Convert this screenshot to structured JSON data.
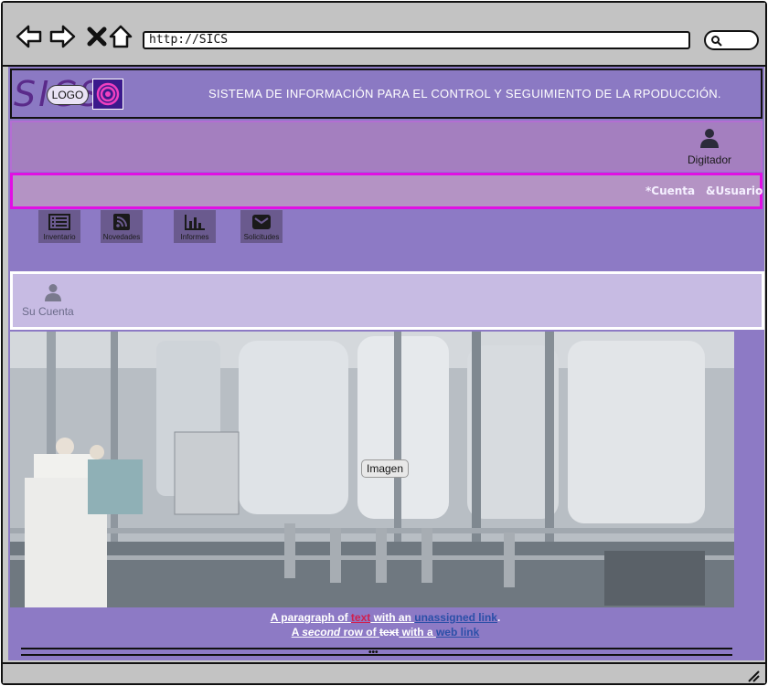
{
  "browser": {
    "url": "http://SICS"
  },
  "header": {
    "brand": "SICS",
    "logo_label": "LOGO",
    "title": "SISTEMA DE INFORMACIÓN PARA EL CONTROL Y SEGUIMIENTO DE LA RPODUCCIÓN."
  },
  "user": {
    "role": "Digitador"
  },
  "account_nav": {
    "cuenta": "*Cuenta",
    "usuario": "&Usuario"
  },
  "modules": [
    {
      "label": "Inventario",
      "icon": "list-icon"
    },
    {
      "label": "Novedades",
      "icon": "rss-icon"
    },
    {
      "label": "Informes",
      "icon": "bar-chart-icon"
    },
    {
      "label": "Solicitudes",
      "icon": "envelope-icon"
    }
  ],
  "account_panel": {
    "label": "Su Cuenta"
  },
  "hero": {
    "caption": "Imagen"
  },
  "paragraph": {
    "line1_pre": "A paragraph of ",
    "line1_text": "text",
    "line1_mid": " with an ",
    "line1_link": "unassigned link",
    "line1_end": ".",
    "line2_pre": "A ",
    "line2_em": "second",
    "line2_mid": " row of ",
    "line2_strike": "text",
    "line2_mid2": " with a ",
    "line2_link": "web link"
  },
  "colors": {
    "page_bg": "#8d7ac5",
    "account_nav_border": "#e10fe4",
    "link_red": "#d11f4e",
    "link_blue": "#2b4fa8"
  }
}
